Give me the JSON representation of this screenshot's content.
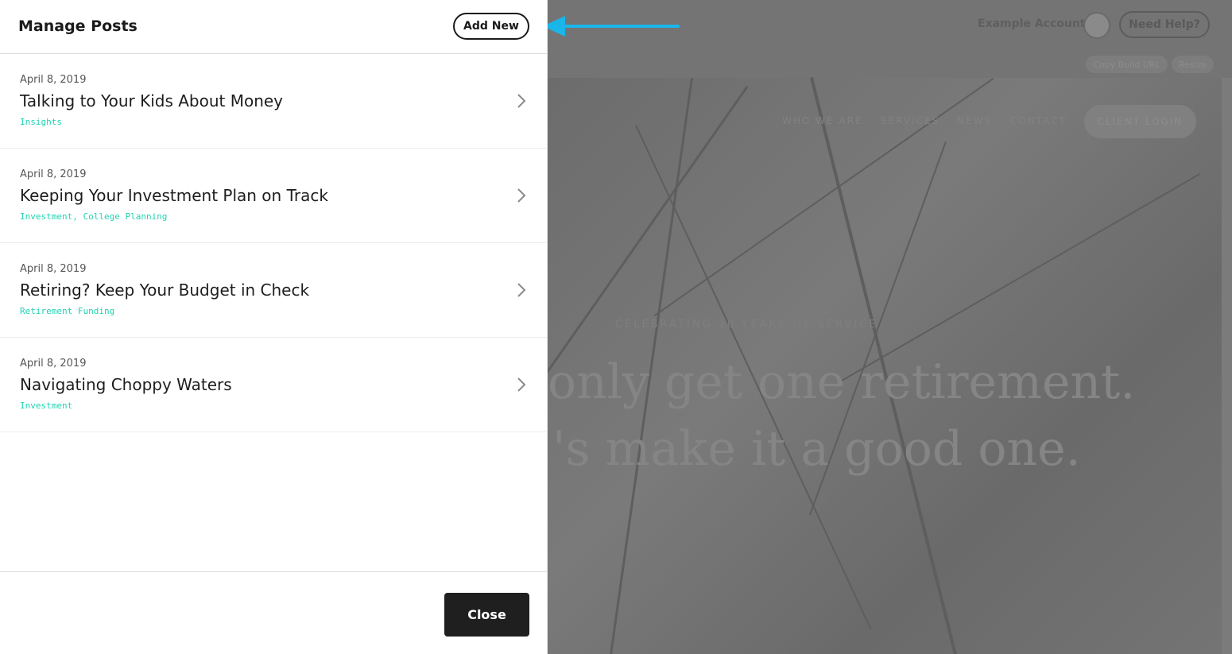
{
  "panel": {
    "title": "Manage Posts",
    "add_new_label": "Add New",
    "close_label": "Close"
  },
  "posts": [
    {
      "date": "April 8, 2019",
      "title": "Talking to Your Kids About Money",
      "tags": "Insights"
    },
    {
      "date": "April 8, 2019",
      "title": "Keeping Your Investment Plan on Track",
      "tags": "Investment, College Planning"
    },
    {
      "date": "April 8, 2019",
      "title": "Retiring? Keep Your Budget in Check",
      "tags": "Retirement Funding"
    },
    {
      "date": "April 8, 2019",
      "title": "Navigating Choppy Waters",
      "tags": "Investment"
    }
  ],
  "background_site": {
    "account_name": "Example Account",
    "help_label": "Need Help?",
    "copy_url_label": "Copy Build URL",
    "resize_label": "Resize",
    "nav": [
      "WHO WE ARE",
      "SERVICES",
      "NEWS",
      "CONTACT"
    ],
    "client_login_label": "CLIENT LOGIN",
    "hero_kicker": "CELEBRATING 20 YEARS OF SERVICE",
    "hero_line_1": "only get one retirement.",
    "hero_line_2": "'s make it a good one."
  },
  "colors": {
    "accent_tag": "#1fd3b3",
    "arrow": "#1ab6ea",
    "overlay": "#727272"
  }
}
